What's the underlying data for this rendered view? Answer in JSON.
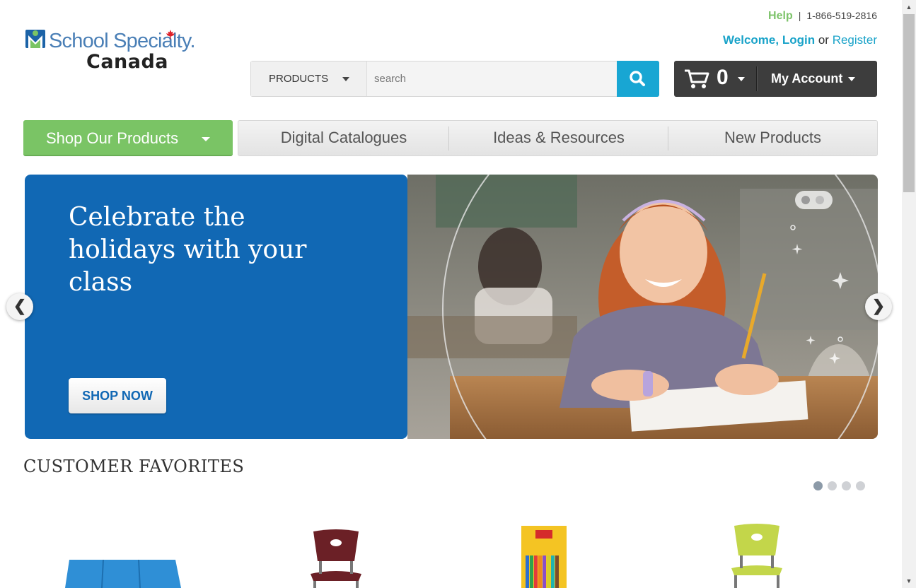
{
  "logo": {
    "brand": "School Specialty.",
    "country": "Canada"
  },
  "topbar": {
    "help": "Help",
    "separator": "|",
    "phone": "1-866-519-2816"
  },
  "welcome": {
    "greeting": "Welcome,",
    "login": "Login",
    "or": "or",
    "register": "Register"
  },
  "search": {
    "category": "PRODUCTS",
    "placeholder": "search"
  },
  "cart": {
    "count": "0",
    "account_label": "My Account"
  },
  "nav": {
    "shop_label": "Shop Our Products",
    "items": [
      "Digital Catalogues",
      "Ideas & Resources",
      "New Products"
    ]
  },
  "hero": {
    "headline": "Celebrate the holidays with your class",
    "cta": "SHOP NOW",
    "prev": "❮",
    "next": "❯"
  },
  "favorites": {
    "title": "CUSTOMER FAVORITES",
    "products": [
      "Blue folding rest mat",
      "Maroon stacking chair",
      "Colored pencils box",
      "Lime green stacking chair"
    ]
  },
  "colors": {
    "brand_green": "#7ac465",
    "brand_blue": "#1168b4",
    "accent_cyan": "#18a6d3",
    "dark": "#3d3d3d"
  },
  "icons": [
    "maple-leaf-icon",
    "search-icon",
    "cart-icon",
    "chevron-down-icon",
    "chevron-left-icon",
    "chevron-right-icon"
  ]
}
